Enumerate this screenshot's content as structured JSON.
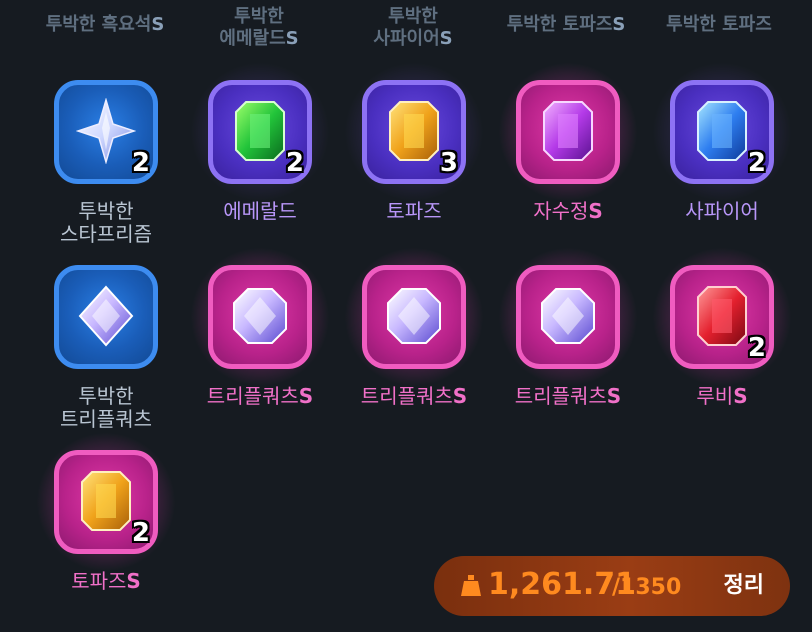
{
  "top_row": [
    {
      "text": "투박한 흑요석",
      "suffix": "S"
    },
    {
      "line1": "투박한",
      "line2": "에메랄드",
      "suffix": "S"
    },
    {
      "line1": "투박한",
      "line2": "사파이어",
      "suffix": "S"
    },
    {
      "text": "투박한 토파즈",
      "suffix": "S"
    },
    {
      "text": "투박한 토파즈",
      "suffix": ""
    }
  ],
  "items": [
    {
      "line1": "투박한",
      "line2": "스타프리즘",
      "suffix": "",
      "count": "2",
      "grade": "blue",
      "icon": "star-prism-gem-icon"
    },
    {
      "line1": "에메랄드",
      "line2": "",
      "suffix": "",
      "count": "2",
      "grade": "purple",
      "icon": "emerald-gem-icon"
    },
    {
      "line1": "토파즈",
      "line2": "",
      "suffix": "",
      "count": "3",
      "grade": "purple",
      "icon": "topaz-gem-icon"
    },
    {
      "line1": "자수정",
      "line2": "",
      "suffix": "S",
      "count": "",
      "grade": "pink",
      "icon": "amethyst-gem-icon"
    },
    {
      "line1": "사파이어",
      "line2": "",
      "suffix": "",
      "count": "2",
      "grade": "purple",
      "icon": "sapphire-gem-icon"
    },
    {
      "line1": "투박한",
      "line2": "트리플쿼츠",
      "suffix": "",
      "count": "",
      "grade": "blue",
      "icon": "triple-quartz-gem-icon"
    },
    {
      "line1": "트리플쿼츠",
      "line2": "",
      "suffix": "S",
      "count": "",
      "grade": "pink",
      "icon": "triple-quartz-gem-icon"
    },
    {
      "line1": "트리플쿼츠",
      "line2": "",
      "suffix": "S",
      "count": "",
      "grade": "pink",
      "icon": "triple-quartz-gem-icon"
    },
    {
      "line1": "트리플쿼츠",
      "line2": "",
      "suffix": "S",
      "count": "",
      "grade": "pink",
      "icon": "triple-quartz-gem-icon"
    },
    {
      "line1": "루비",
      "line2": "",
      "suffix": "S",
      "count": "2",
      "grade": "pink",
      "icon": "ruby-gem-icon"
    },
    {
      "line1": "토파즈",
      "line2": "",
      "suffix": "S",
      "count": "2",
      "grade": "pink",
      "icon": "topaz-gem-icon"
    }
  ],
  "weight": {
    "current": "1,261.71",
    "max": "/1350",
    "icon": "weight-bag-icon"
  },
  "sort_button": {
    "label": "정리"
  },
  "colors": {
    "background": "#161b21",
    "grade_blue": "#1a5db8",
    "grade_purple": "#4a2fc0",
    "grade_pink": "#b8228a",
    "weight_text": "#ff8a1f",
    "weight_bar": "#9a3d14"
  }
}
